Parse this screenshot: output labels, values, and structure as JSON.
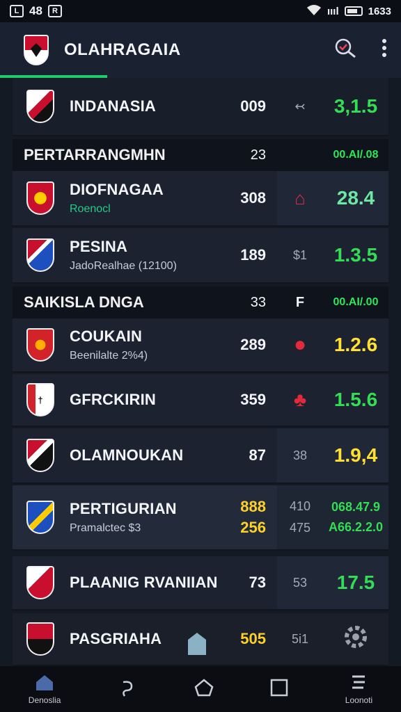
{
  "status_bar": {
    "left_text": "48",
    "left_box1": "L",
    "left_box2": "R",
    "network": "ıııl",
    "time": "1633"
  },
  "header": {
    "title": "OLAHRAGAIA",
    "search_icon": "search-icon",
    "menu_icon": "more-vert-icon"
  },
  "colors": {
    "accent": "#1fcc6a",
    "green": "#33dd55",
    "yellow": "#ffe033",
    "background": "#141a24"
  },
  "rows": [
    {
      "name": "INDANASIA",
      "sub": "",
      "num": "009",
      "aux": "↢",
      "odd": "3,1.5"
    },
    {
      "name": "DIOFNAGAA",
      "sub": "Roenocl",
      "num": "308",
      "aux": "⌂",
      "odd": "28.4"
    },
    {
      "name": "PESINA",
      "sub": "JadoRealhae (12100)",
      "num": "189",
      "aux": "$1",
      "odd": "1.3.5"
    },
    {
      "name": "COUKAIN",
      "sub": "Beenilalte 2%4)",
      "num": "289",
      "aux": "●",
      "odd": "1.2.6"
    },
    {
      "name": "GFRCKIRIN",
      "sub": "",
      "num": "359",
      "aux": "♣",
      "odd": "1.5.6"
    },
    {
      "name": "OLAMNOUKAN",
      "sub": "",
      "num": "87",
      "aux": "38",
      "odd": "1.9,4"
    },
    {
      "name": "PERTIGURIAN",
      "sub": "Pramalctec $3",
      "num": "888",
      "num2": "256",
      "aux": "410",
      "aux2": "475",
      "odd": "068.47.9",
      "odd2": "A66.2.2.0"
    },
    {
      "name": "PLAANIG RVANIIAN",
      "sub": "",
      "num": "73",
      "aux": "53",
      "odd": "17.5"
    },
    {
      "name": "PASGRIAHA",
      "sub": "",
      "num": "505",
      "aux": "5i1",
      "odd": ""
    }
  ],
  "sections": [
    {
      "title": "PERTARRANGMHN",
      "count": "23",
      "mid": "",
      "time": "00.AI/.08"
    },
    {
      "title": "SAIKISLA DNGA",
      "count": "33",
      "mid": "F",
      "time": "00.AI/.00"
    }
  ],
  "nav": {
    "home_label": "Denoslia",
    "home_icon": "home-icon",
    "back_icon": "back-icon",
    "circle_icon": "circle-home-icon",
    "square_icon": "recents-icon",
    "right_label": "Loonoti",
    "right_icon": "menu-icon"
  }
}
